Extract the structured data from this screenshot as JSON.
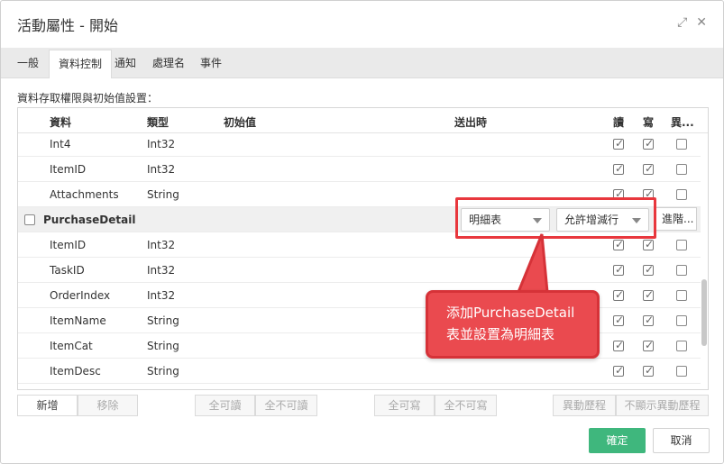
{
  "dialog": {
    "title": "活動屬性 - 開始"
  },
  "tabs": [
    "一般",
    "資料控制",
    "通知",
    "處理名",
    "事件"
  ],
  "section_label": "資料存取權限與初始值設置：",
  "columns": {
    "data": "資料",
    "type": "類型",
    "init": "初始值",
    "send": "送出時",
    "read": "讀",
    "write": "寫",
    "change": "異..."
  },
  "rows_top": [
    {
      "name": "Int4",
      "type": "Int32",
      "read": true,
      "write": true,
      "change": false
    },
    {
      "name": "ItemID",
      "type": "Int32",
      "read": true,
      "write": true,
      "change": false
    },
    {
      "name": "Attachments",
      "type": "String",
      "read": true,
      "write": true,
      "change": false
    }
  ],
  "group": {
    "name": "PurchaseDetail",
    "table_type": "明細表",
    "row_mode": "允許增減行",
    "advanced": "進階..."
  },
  "rows_detail": [
    {
      "name": "ItemID",
      "type": "Int32",
      "read": true,
      "write": true,
      "change": false
    },
    {
      "name": "TaskID",
      "type": "Int32",
      "read": true,
      "write": true,
      "change": false
    },
    {
      "name": "OrderIndex",
      "type": "Int32",
      "read": true,
      "write": true,
      "change": false
    },
    {
      "name": "ItemName",
      "type": "String",
      "read": true,
      "write": true,
      "change": false
    },
    {
      "name": "ItemCat",
      "type": "String",
      "read": true,
      "write": true,
      "change": false
    },
    {
      "name": "ItemDesc",
      "type": "String",
      "read": true,
      "write": true,
      "change": false
    }
  ],
  "callout": {
    "line1": "添加PurchaseDetail",
    "line2": "表並設置為明細表"
  },
  "toolbar": {
    "add": "新增",
    "remove": "移除",
    "all_read": "全可讀",
    "none_read": "全不可讀",
    "all_write": "全可寫",
    "none_write": "全不可寫",
    "change_history": "異動歷程",
    "hide_change_history": "不顯示異動歷程"
  },
  "footer": {
    "ok": "確定",
    "cancel": "取消"
  },
  "colors": {
    "accent_green": "#3fb77d",
    "highlight_red": "#e8373d"
  }
}
